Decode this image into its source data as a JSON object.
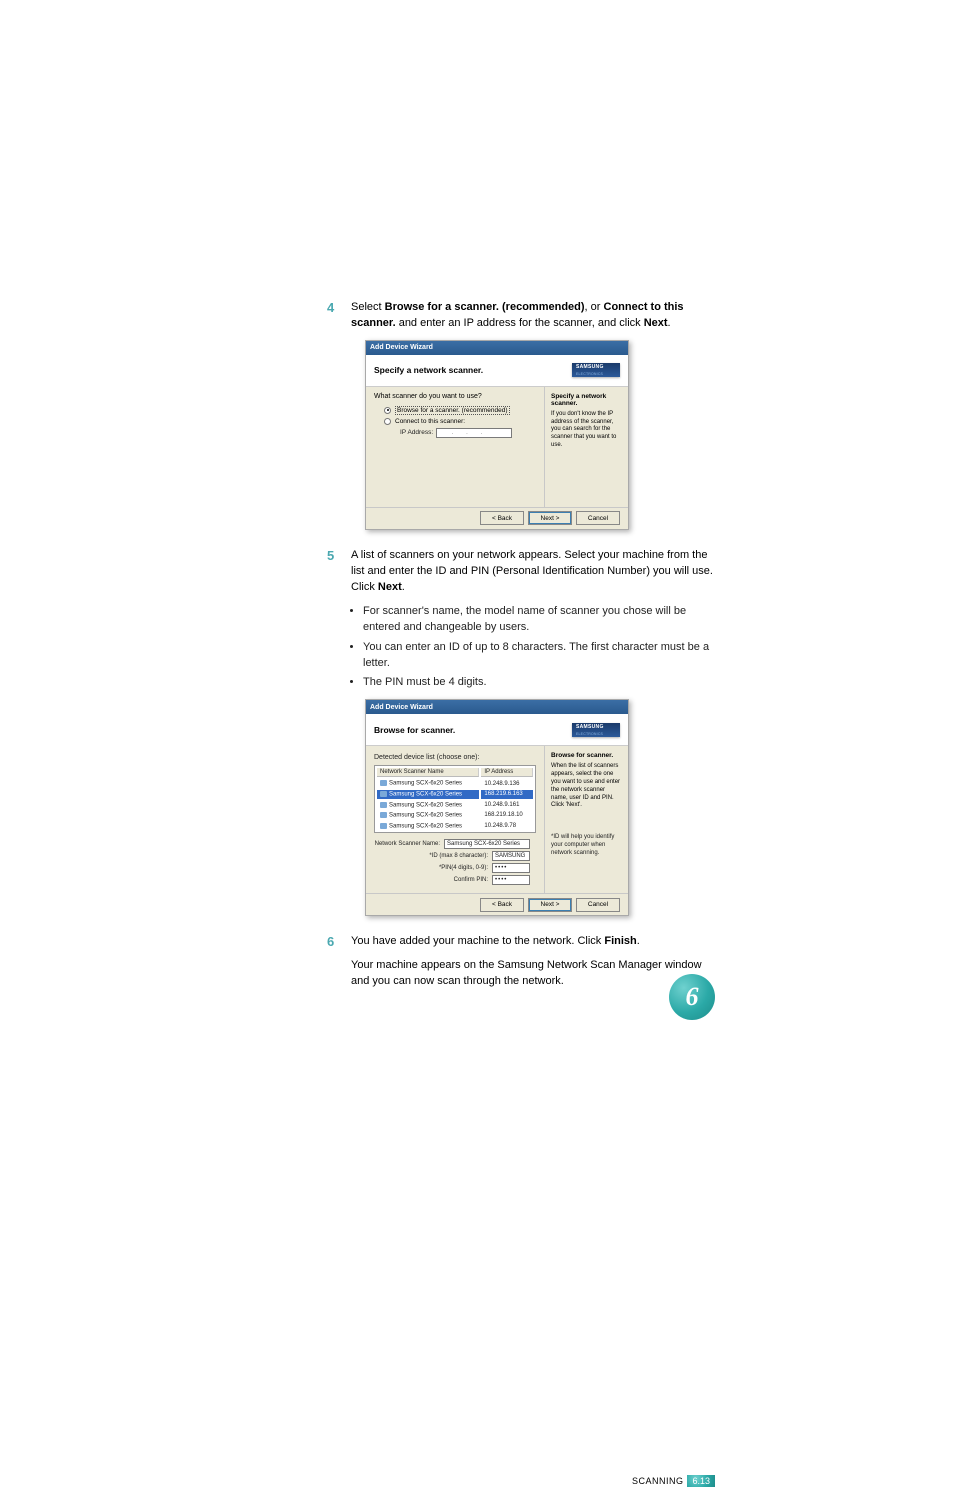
{
  "chapter_badge": "6",
  "footer": {
    "label": "SCANNING",
    "page": "6.13"
  },
  "steps": {
    "s4": {
      "num": "4",
      "l1_pre": "Select ",
      "l1_b1": "Browse for a scanner. (recommended)",
      "l1_mid": ", or ",
      "l2_b1": "Connect to this scanner.",
      "l2_post": " and enter an IP address for the scanner, and click ",
      "l2_b2": "Next",
      "l2_end": "."
    },
    "s5": {
      "num": "5",
      "text_pre": "A list of scanners on your network appears. Select your machine from the list and enter the ID and PIN (Personal Identification Number) you will use. Click ",
      "text_b": "Next",
      "text_end": ".",
      "b1": "For scanner's name, the model name of scanner you chose will be entered and changeable by users.",
      "b2": "You can enter an ID of up to 8 characters. The first character must be a letter.",
      "b3": "The PIN must be 4 digits."
    },
    "s6": {
      "num": "6",
      "l1_pre": "You have added your machine to the network. Click ",
      "l1_b": "Finish",
      "l1_end": ".",
      "l2": "Your machine appears on the Samsung Network Scan Manager window and you can now scan through the network."
    }
  },
  "wizard1": {
    "titlebar": "Add Device Wizard",
    "header": "Specify a network scanner.",
    "question": "What scanner do you want to use?",
    "radio1": "Browse for a scanner. (recommended)",
    "radio2": "Connect to this scanner:",
    "ip_label": "IP Address:",
    "side_title": "Specify a network scanner.",
    "side_text": "If you don't know the IP address of the scanner, you can search for the scanner that you want to use.",
    "btn_back": "< Back",
    "btn_next": "Next >",
    "btn_cancel": "Cancel"
  },
  "wizard2": {
    "titlebar": "Add Device Wizard",
    "header": "Browse for scanner.",
    "subhead": "Detected device list (choose one):",
    "col1": "Network Scanner Name",
    "col2": "IP Address",
    "rows": [
      {
        "name": "Samsung SCX-6x20 Series",
        "ip": "10.248.9.136"
      },
      {
        "name": "Samsung SCX-6x20 Series",
        "ip": "168.219.6.163"
      },
      {
        "name": "Samsung SCX-6x20 Series",
        "ip": "10.248.9.161"
      },
      {
        "name": "Samsung SCX-6x20 Series",
        "ip": "168.219.18.10"
      },
      {
        "name": "Samsung SCX-6x20 Series",
        "ip": "10.248.9.78"
      }
    ],
    "f1_label": "Network Scanner Name:",
    "f1_value": "Samsung SCX-6x20 Series",
    "f2_label": "*ID (max 8 character):",
    "f2_value": "SAMSUNG",
    "f3_label": "*PIN(4 digits, 0-9):",
    "f3_value": "••••",
    "f4_label": "Confirm PIN:",
    "f4_value": "••••",
    "side_title": "Browse for scanner.",
    "side_text": "When the list of scanners appears, select the one you want to use and enter the network scanner name, user ID and PIN. Click 'Next'.",
    "side_note": "*ID will help you identify your computer when network scanning.",
    "btn_back": "< Back",
    "btn_next": "Next >",
    "btn_cancel": "Cancel"
  }
}
